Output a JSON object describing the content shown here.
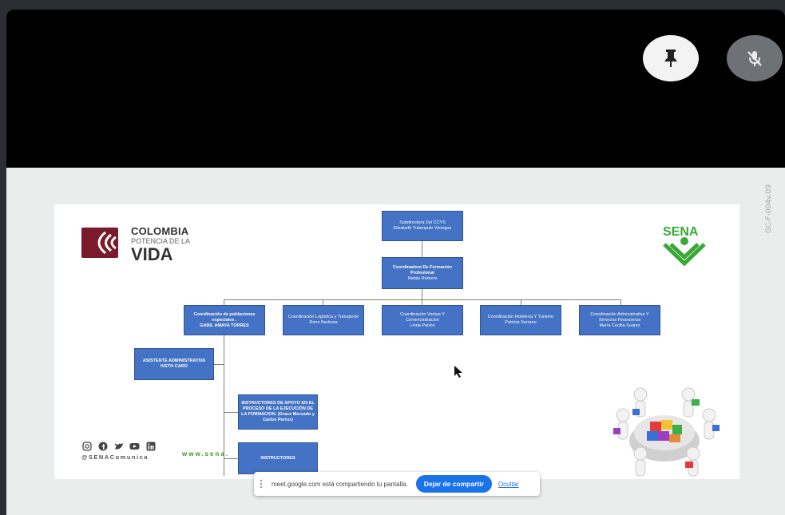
{
  "meet": {
    "pin_icon": "pin-icon",
    "mute_icon": "mic-off-icon"
  },
  "document_code": "GC-F-004v.09",
  "slide": {
    "logo_colombia": {
      "line1": "COLOMBIA",
      "line2": "POTENCIA DE LA",
      "line3": "VIDA"
    },
    "logo_sena": "SENA",
    "org": {
      "root": {
        "title": "Subdirectora Del CCYS",
        "name": "Elisabeth Tulampule Venegas"
      },
      "coord_formacion": {
        "title": "Coordinadora De Formación Profesional",
        "name": "Nataly Romero"
      },
      "coords": [
        {
          "title": "Coordinación de poblaciones especiales .",
          "name": "GABIL AMAYA TORRES"
        },
        {
          "title": "Coordinación Logística y Transporte",
          "name": "Rene Barbosa"
        },
        {
          "title": "Coordinación Ventas Y Comercialización",
          "name": "Linda Patrón"
        },
        {
          "title": "Coordinación Hotelería Y Turismo",
          "name": "Patricia Serrano"
        },
        {
          "title": "Coordinación Administrativa Y Servicios Financieros",
          "name": "María Cecilia Suarez"
        }
      ],
      "asistente": {
        "title": "ASISTENTE ADMINISTRATIVA",
        "name": "IVETH CARO"
      },
      "instructores_apoyo": {
        "title": "INSTRUCTORES DE APOYO EN EL PROCESO DE LA EJECUCIÓN DE LA FORMACION. (Grace Mercado y Carlos Perruz)"
      },
      "instructores": {
        "title": "INSTRUCTORES"
      }
    },
    "social_icons": [
      "instagram-icon",
      "facebook-icon",
      "twitter-icon",
      "youtube-icon",
      "linkedin-icon"
    ],
    "social_handle": "@SENAComunica",
    "website": "www.sena."
  },
  "share_bar": {
    "message": "meet.google.com está compartiendo tu pantalla.",
    "stop_label": "Dejar de compartir",
    "hide_label": "Ocultar"
  },
  "colors": {
    "box_blue": "#4472c4",
    "meet_blue": "#1a73e8",
    "colombia_red": "#7a1a2c",
    "sena_green": "#39a935"
  }
}
